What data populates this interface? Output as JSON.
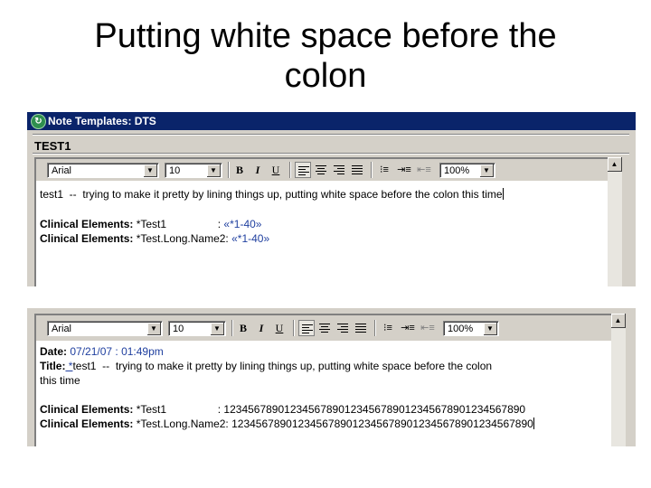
{
  "slide": {
    "title": "Putting white space before the\ncolon"
  },
  "window1": {
    "title": "Note Templates: DTS",
    "test_label": "TEST1",
    "toolbar": {
      "font": "Arial",
      "size": "10",
      "bold": "B",
      "italic": "I",
      "underline": "U",
      "zoom": "100%"
    },
    "body": {
      "line1": "test1  --  trying to make it pretty by lining things up, putting white space before the colon this time",
      "row1_label": "Clinical Elements:",
      "row1_name": " *Test1                 ",
      "row1_colon": ":",
      "row1_value": " «*1-40»",
      "row2_label": "Clinical Elements:",
      "row2_name": " *Test.Long.Name2:",
      "row2_value": " «*1-40»"
    }
  },
  "window2": {
    "toolbar": {
      "font": "Arial",
      "size": "10",
      "bold": "B",
      "italic": "I",
      "underline": "U",
      "zoom": "100%"
    },
    "body": {
      "date_label": "Date:",
      "date_value": " 07/21/07 : 01:49pm",
      "title_label": "Title:",
      "title_star": " *",
      "title_value": "test1  --  trying to make it pretty by lining things up, putting white space before the colon",
      "title_cont": "this time",
      "row1_label": "Clinical Elements:",
      "row1_name": " *Test1                 ",
      "row1_value": ": 12345678901234567890123456789012345678901234567890",
      "row2_label": "Clinical Elements:",
      "row2_name": " *Test.Long.Name2:",
      "row2_value": " 12345678901234567890123456789012345678901234567890"
    }
  }
}
